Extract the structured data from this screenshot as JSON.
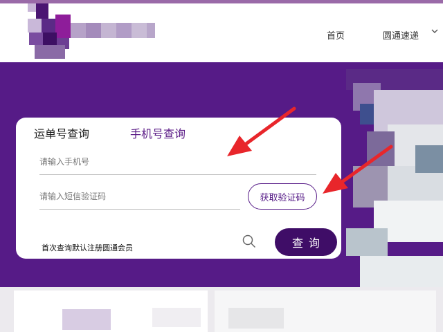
{
  "header": {
    "nav": {
      "home_label": "首页",
      "brand_label": "圆通速递"
    }
  },
  "query_card": {
    "tabs": [
      {
        "label": "运单号查询",
        "active": false
      },
      {
        "label": "手机号查询",
        "active": true
      }
    ],
    "phone_input": {
      "placeholder": "请输入手机号",
      "value": ""
    },
    "code_input": {
      "placeholder": "请输入短信验证码",
      "value": ""
    },
    "get_code_label": "获取验证码",
    "query_label": "查询",
    "hint": "首次查询默认注册圆通会员"
  },
  "colors": {
    "brand_purple": "#561b87",
    "button_purple": "#3f0d67",
    "arrow_red": "#e8262b"
  }
}
